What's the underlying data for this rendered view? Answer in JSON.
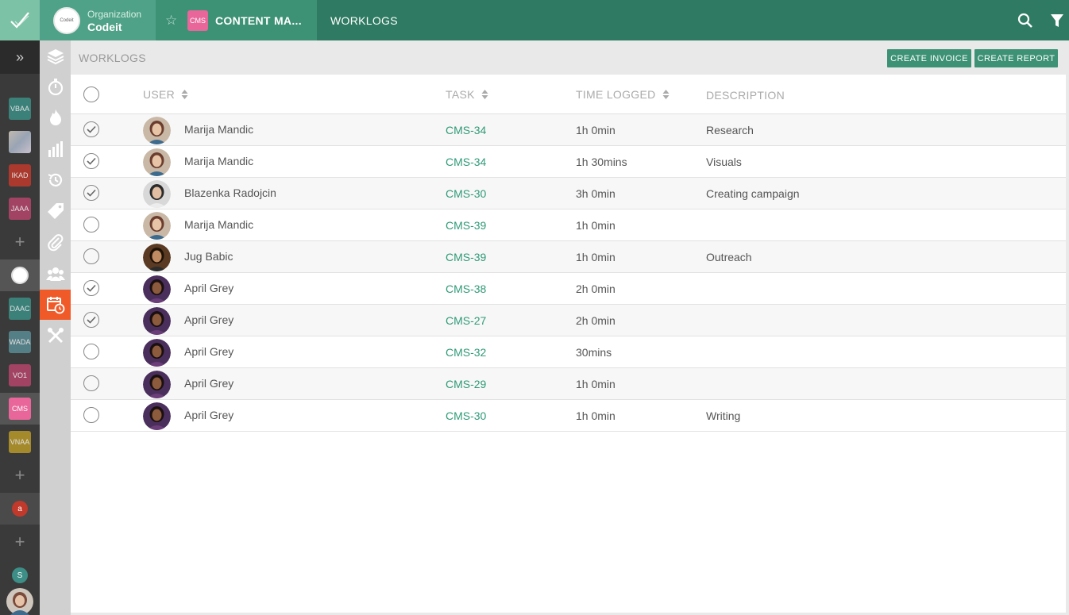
{
  "org": {
    "label": "Organization",
    "name": "Codeit",
    "logo_text": "Codeit"
  },
  "project": {
    "badge": "CMS",
    "name": "CONTENT MA..."
  },
  "breadcrumb": "WORKLOGS",
  "page": {
    "title": "WORKLOGS",
    "create_invoice": "CREATE INVOICE",
    "create_report": "CREATE REPORT"
  },
  "columns": {
    "user": "USER",
    "task": "TASK",
    "time": "TIME LOGGED",
    "description": "DESCRIPTION"
  },
  "rail": {
    "badges": [
      {
        "label": "VBAA",
        "color": "#3c8e86"
      },
      {
        "label": "IKAD",
        "color": "#c0392b"
      },
      {
        "label": "JAAA",
        "color": "#b5456b"
      },
      {
        "label": "DAAC",
        "color": "#3c8e86"
      },
      {
        "label": "WADA",
        "color": "#5a8c94"
      },
      {
        "label": "VO1",
        "color": "#b5456b"
      },
      {
        "label": "CMS",
        "color": "#e8669a"
      },
      {
        "label": "VNAA",
        "color": "#b8982a"
      }
    ],
    "dots": [
      {
        "label": "a",
        "color": "#c0392b"
      },
      {
        "label": "S",
        "color": "#3c8e86"
      }
    ]
  },
  "colors": {
    "accent": "#3d9175",
    "topbar": "#2f7a62",
    "active_icon": "#f05a28",
    "task_link": "#2f9a78"
  },
  "rows": [
    {
      "checked": true,
      "user": "Marija Mandic",
      "task": "CMS-34",
      "time": "1h 0min",
      "description": "Research"
    },
    {
      "checked": true,
      "user": "Marija Mandic",
      "task": "CMS-34",
      "time": "1h 30mins",
      "description": "Visuals"
    },
    {
      "checked": true,
      "user": "Blazenka Radojcin",
      "task": "CMS-30",
      "time": "3h 0min",
      "description": "Creating campaign"
    },
    {
      "checked": false,
      "user": "Marija Mandic",
      "task": "CMS-39",
      "time": "1h 0min",
      "description": ""
    },
    {
      "checked": false,
      "user": "Jug Babic",
      "task": "CMS-39",
      "time": "1h 0min",
      "description": "Outreach"
    },
    {
      "checked": true,
      "user": "April Grey",
      "task": "CMS-38",
      "time": "2h 0min",
      "description": ""
    },
    {
      "checked": true,
      "user": "April Grey",
      "task": "CMS-27",
      "time": "2h 0min",
      "description": ""
    },
    {
      "checked": false,
      "user": "April Grey",
      "task": "CMS-32",
      "time": "30mins",
      "description": ""
    },
    {
      "checked": false,
      "user": "April Grey",
      "task": "CMS-29",
      "time": "1h 0min",
      "description": ""
    },
    {
      "checked": false,
      "user": "April Grey",
      "task": "CMS-30",
      "time": "1h 0min",
      "description": "Writing"
    }
  ]
}
